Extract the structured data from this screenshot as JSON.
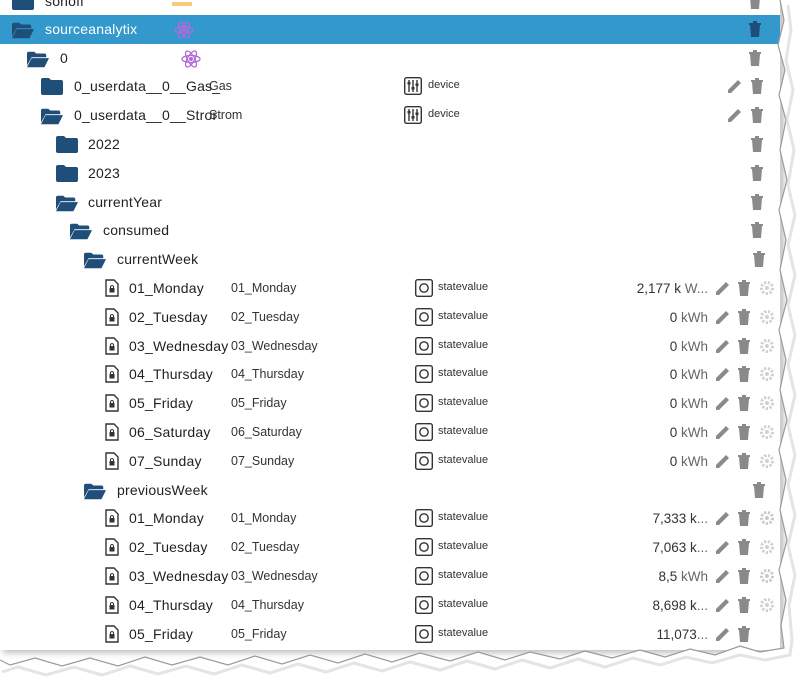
{
  "colors": {
    "selected_bg": "#3399cc",
    "folder": "#1f4e79",
    "icon_gray": "#8a8a8a"
  },
  "top_partial": {
    "name": "sonoff"
  },
  "rows": [
    {
      "id": "sourceanalytix",
      "name": "sourceanalytix",
      "selected": true
    },
    {
      "id": "n0",
      "name": "0"
    },
    {
      "id": "gas",
      "name": "0_userdata__0__Gas_",
      "comment": "Gas",
      "type": "device"
    },
    {
      "id": "strom",
      "name": "0_userdata__0__Stror",
      "comment": "Strom",
      "type": "device"
    },
    {
      "id": "y2022",
      "name": "2022"
    },
    {
      "id": "y2023",
      "name": "2023"
    },
    {
      "id": "currentyear",
      "name": "currentYear"
    },
    {
      "id": "consumed",
      "name": "consumed"
    },
    {
      "id": "currentweek",
      "name": "currentWeek"
    },
    {
      "id": "cw1",
      "name": "01_Monday",
      "comment": "01_Monday",
      "type": "statevalue",
      "value": "2,177 k",
      "unit": "W..."
    },
    {
      "id": "cw2",
      "name": "02_Tuesday",
      "comment": "02_Tuesday",
      "type": "statevalue",
      "value": "0",
      "unit": "kWh"
    },
    {
      "id": "cw3",
      "name": "03_Wednesday",
      "comment": "03_Wednesday",
      "type": "statevalue",
      "value": "0",
      "unit": "kWh"
    },
    {
      "id": "cw4",
      "name": "04_Thursday",
      "comment": "04_Thursday",
      "type": "statevalue",
      "value": "0",
      "unit": "kWh"
    },
    {
      "id": "cw5",
      "name": "05_Friday",
      "comment": "05_Friday",
      "type": "statevalue",
      "value": "0",
      "unit": "kWh"
    },
    {
      "id": "cw6",
      "name": "06_Saturday",
      "comment": "06_Saturday",
      "type": "statevalue",
      "value": "0",
      "unit": "kWh"
    },
    {
      "id": "cw7",
      "name": "07_Sunday",
      "comment": "07_Sunday",
      "type": "statevalue",
      "value": "0",
      "unit": "kWh"
    },
    {
      "id": "previousweek",
      "name": "previousWeek"
    },
    {
      "id": "pw1",
      "name": "01_Monday",
      "comment": "01_Monday",
      "type": "statevalue",
      "value": "7,333 k",
      "unit": "..."
    },
    {
      "id": "pw2",
      "name": "02_Tuesday",
      "comment": "02_Tuesday",
      "type": "statevalue",
      "value": "7,063 k",
      "unit": "..."
    },
    {
      "id": "pw3",
      "name": "03_Wednesday",
      "comment": "03_Wednesday",
      "type": "statevalue",
      "value": "8,5",
      "unit": "kWh"
    },
    {
      "id": "pw4",
      "name": "04_Thursday",
      "comment": "04_Thursday",
      "type": "statevalue",
      "value": "8,698 k",
      "unit": "..."
    },
    {
      "id": "pw5",
      "name": "05_Friday",
      "comment": "05_Friday",
      "type": "statevalue",
      "value": "11,073",
      "unit": "..."
    }
  ]
}
